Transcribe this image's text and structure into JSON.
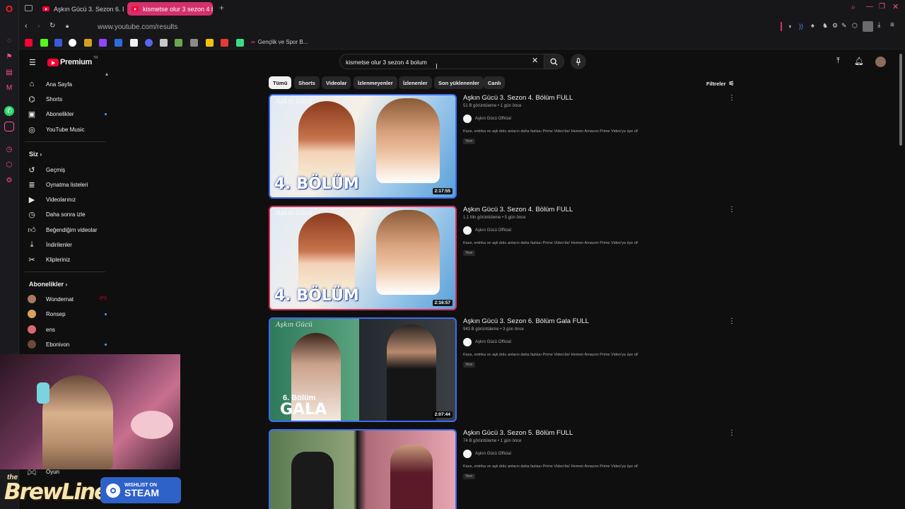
{
  "browser": {
    "tabs": [
      {
        "label": "Aşkın Gücü 3. Sezon 6. B"
      },
      {
        "label": "kismetse olur 3 sezon 4 b"
      }
    ],
    "url": "www.youtube.com/results",
    "bookmark_folder": "Gençlik ve Spor B..."
  },
  "youtube": {
    "logo_text": "Premium",
    "logo_badge": "TR",
    "search_query": "kismetse olur 3 sezon 4 bolum",
    "sidebar": {
      "main": [
        {
          "label": "Ana Sayfa",
          "icon": "home-icon"
        },
        {
          "label": "Shorts",
          "icon": "shorts-icon"
        },
        {
          "label": "Abonelikler",
          "icon": "subscriptions-icon"
        },
        {
          "label": "YouTube Music",
          "icon": "music-icon"
        }
      ],
      "you_header": "Siz",
      "you": [
        {
          "label": "Geçmiş",
          "icon": "history-icon"
        },
        {
          "label": "Oynatma listeleri",
          "icon": "playlist-icon"
        },
        {
          "label": "Videolarınız",
          "icon": "your-videos-icon"
        },
        {
          "label": "Daha sonra izle",
          "icon": "watch-later-icon"
        },
        {
          "label": "Beğendiğim videolar",
          "icon": "liked-icon"
        },
        {
          "label": "İndirilenler",
          "icon": "download-icon"
        },
        {
          "label": "Klipleriniz",
          "icon": "clips-icon"
        }
      ],
      "subs_header": "Abonelikler",
      "subs": [
        {
          "label": "Wondernat",
          "color": "#a97860",
          "live": true
        },
        {
          "label": "Ronsep",
          "color": "#d9a35a",
          "live": false
        },
        {
          "label": "ens",
          "color": "#d9686f",
          "live": false
        },
        {
          "label": "Ebonivon",
          "color": "#6b4a3a",
          "live": false
        }
      ],
      "bottom_item": "Oyun"
    },
    "chips": [
      "Tümü",
      "Shorts",
      "Videolar",
      "İzlenmeyenler",
      "İzlenenler",
      "Son yüklenenler",
      "Canlı"
    ],
    "filters_label": "Filtreler",
    "videos": [
      {
        "title": "Aşkın Gücü 3. Sezon 4. Bölüm FULL",
        "meta": "51 B görüntüleme • 1 gün önce",
        "channel": "Aşkın Gücü Official",
        "desc": "Kaos, entrika ve aşk dolu anların daha fazlası Prime Video'da! Hemen Amazon Prime Video'ya üye ol!",
        "badge": "Yeni",
        "duration": "2:17:55",
        "overlay": "4. BÖLÜM"
      },
      {
        "title": "Aşkın Gücü 3. Sezon 4. Bölüm FULL",
        "meta": "1,1 Mn görüntüleme • 5 gün önce",
        "channel": "Aşkın Gücü Official",
        "desc": "Kaos, entrika ve aşk dolu anların daha fazlası Prime Video'da! Hemen Amazon Prime Video'ya üye ol!",
        "badge": "Yeni",
        "duration": "2:16:57",
        "overlay": "4. BÖLÜM"
      },
      {
        "title": "Aşkın Gücü 3. Sezon 6. Bölüm Gala FULL",
        "meta": "943 B görüntüleme • 3 gün önce",
        "channel": "Aşkın Gücü Official",
        "desc": "Kaos, entrika ve aşk dolu anların daha fazlası Prime Video'da! Hemen Amazon Prime Video'ya üye ol!",
        "badge": "Yeni",
        "duration": "2:07:44",
        "overlay": "6. Bölüm",
        "overlay2": "GALA"
      },
      {
        "title": "Aşkın Gücü 3. Sezon 5. Bölüm FULL",
        "meta": "74 B görüntüleme • 1 gün önce",
        "channel": "Aşkın Gücü Official",
        "desc": "Kaos, entrika ve aşk dolu anların daha fazlası Prime Video'da! Hemen Amazon Prime Video'ya üye ol!",
        "badge": "Yeni",
        "duration": ""
      }
    ]
  },
  "stream_overlay": {
    "brand_small": "the",
    "brand_big": "BrewLine",
    "steam_top": "WISHLIST ON",
    "steam_bottom": "STEAM"
  }
}
